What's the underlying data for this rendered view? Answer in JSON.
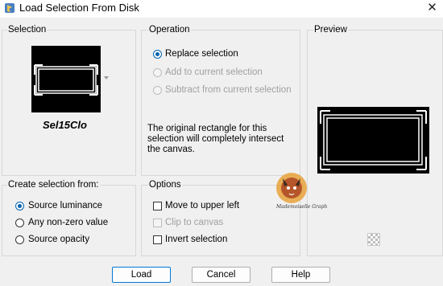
{
  "window": {
    "title": "Load Selection From Disk",
    "close_glyph": "✕"
  },
  "selection": {
    "label": "Selection",
    "preset_name": "Sel15Clo",
    "dropdown_icon": "chevron-down-icon"
  },
  "operation": {
    "label": "Operation",
    "options": [
      {
        "label": "Replace selection",
        "checked": true,
        "enabled": true
      },
      {
        "label": "Add to current selection",
        "checked": false,
        "enabled": false
      },
      {
        "label": "Subtract from current selection",
        "checked": false,
        "enabled": false
      }
    ],
    "description_lines": [
      "The original rectangle for this",
      "selection will completely intersect",
      "the canvas."
    ]
  },
  "preview": {
    "label": "Preview",
    "toggle_icon": "checker-icon",
    "watermark_text": "Mademoiselle Graph"
  },
  "create_from": {
    "label": "Create selection from:",
    "options": [
      {
        "label": "Source luminance",
        "checked": true
      },
      {
        "label": "Any non-zero value",
        "checked": false
      },
      {
        "label": "Source opacity",
        "checked": false
      }
    ]
  },
  "options": {
    "label": "Options",
    "items": [
      {
        "label": "Move to upper left",
        "checked": false,
        "enabled": true
      },
      {
        "label": "Clip to canvas",
        "checked": false,
        "enabled": false
      },
      {
        "label": "Invert selection",
        "checked": false,
        "enabled": true
      }
    ]
  },
  "buttons": {
    "load": "Load",
    "cancel": "Cancel",
    "help": "Help"
  },
  "colors": {
    "accent": "#0063b1",
    "default_button_border": "#0078d7",
    "disabled_text": "#a0a0a0",
    "group_border": "#d7d7d7"
  }
}
